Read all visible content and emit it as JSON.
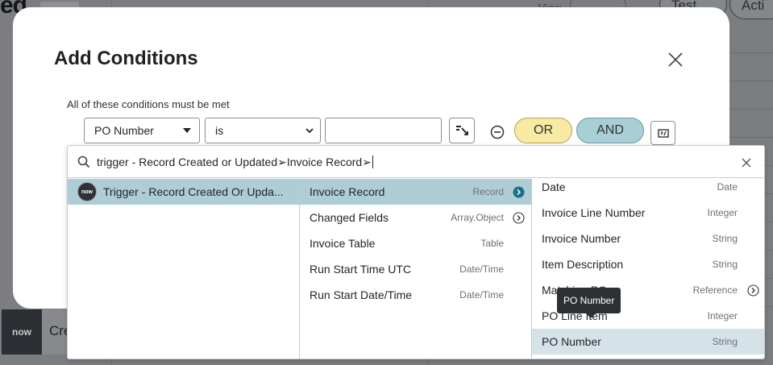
{
  "background": {
    "title_fragment": "ed",
    "view_label": "View",
    "test_button": "Test",
    "activate_fragment": "Acti",
    "logo_text": "now",
    "row_fragment": "Cre"
  },
  "modal": {
    "title": "Add Conditions",
    "condition_label": "All of these conditions must be met",
    "field_select": "PO Number",
    "operator_select": "is",
    "value_input": "",
    "or_label": "OR",
    "and_label": "AND"
  },
  "picker": {
    "search_value": "trigger - Record Created or Updated➢Invoice Record➢",
    "column1": [
      {
        "label": "Trigger - Record Created Or Upda...",
        "badge": "now"
      }
    ],
    "column2": [
      {
        "label": "Invoice Record",
        "type": "Record"
      },
      {
        "label": "Changed Fields",
        "type": "Array.Object"
      },
      {
        "label": "Invoice Table",
        "type": "Table"
      },
      {
        "label": "Run Start Time UTC",
        "type": "Date/Time"
      },
      {
        "label": "Run Start Date/Time",
        "type": "Date/Time"
      }
    ],
    "column3": [
      {
        "label": "Date",
        "type": "Date"
      },
      {
        "label": "Invoice Line Number",
        "type": "Integer"
      },
      {
        "label": "Invoice Number",
        "type": "String"
      },
      {
        "label": "Item Description",
        "type": "String"
      },
      {
        "label": "Matching PO",
        "type": "Reference"
      },
      {
        "label": "PO Line Item",
        "type": "Integer"
      },
      {
        "label": "PO Number",
        "type": "String"
      }
    ]
  },
  "tooltip": "PO Number"
}
